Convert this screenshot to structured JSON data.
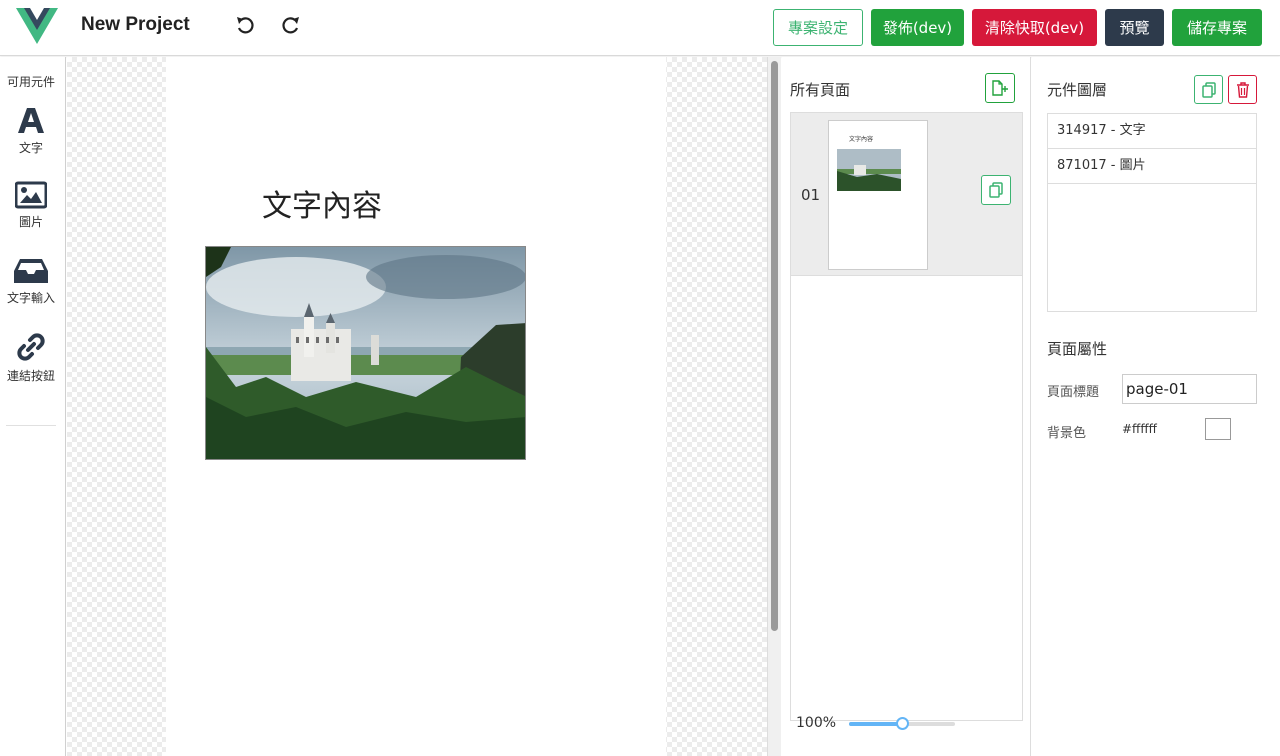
{
  "header": {
    "project_title": "New Project",
    "buttons": {
      "settings": "專案設定",
      "publish": "發佈(dev)",
      "clear_cache": "清除快取(dev)",
      "preview": "預覽",
      "save": "儲存專案"
    }
  },
  "palette": {
    "title": "可用元件",
    "items": [
      {
        "label": "文字",
        "icon": "text-icon"
      },
      {
        "label": "圖片",
        "icon": "image-icon"
      },
      {
        "label": "文字輸入",
        "icon": "inbox-icon"
      },
      {
        "label": "連結按鈕",
        "icon": "link-icon"
      }
    ]
  },
  "canvas": {
    "text_content": "文字內容",
    "image_alt": "castle-photo"
  },
  "pages_panel": {
    "title": "所有頁面",
    "pages": [
      {
        "number": "01",
        "thumb_text": "文字內容"
      }
    ],
    "zoom": {
      "label": "100%",
      "level": 0.5
    }
  },
  "layers_panel": {
    "title": "元件圖層",
    "layers": [
      {
        "label": "314917 - 文字"
      },
      {
        "label": "871017 - 圖片"
      }
    ]
  },
  "page_properties": {
    "title": "頁面屬性",
    "page_title_label": "頁面標題",
    "page_title_value": "page-01",
    "bg_color_label": "背景色",
    "bg_color_value": "#ffffff"
  },
  "colors": {
    "brand_green": "#21a23c",
    "danger_red": "#d6183a",
    "dark": "#2d3a4b",
    "vue_green": "#41b883",
    "vue_dark": "#35495e"
  }
}
